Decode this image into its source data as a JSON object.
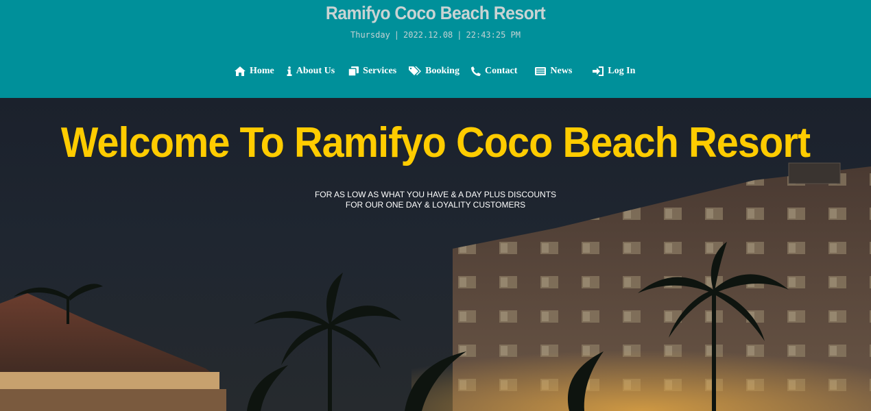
{
  "header": {
    "title": "Ramifyo Coco Beach Resort",
    "day": "Thursday",
    "date": "2022.12.08",
    "time": "22:43:25 PM",
    "background_color": "#00909a"
  },
  "nav": {
    "items": [
      {
        "label": "Home",
        "icon": "home-icon"
      },
      {
        "label": "About Us",
        "icon": "info-icon"
      },
      {
        "label": "Services",
        "icon": "copy-icon"
      },
      {
        "label": "Booking",
        "icon": "tags-icon"
      },
      {
        "label": "Contact",
        "icon": "phone-icon"
      },
      {
        "label": "News",
        "icon": "newspaper-icon"
      },
      {
        "label": "Log In",
        "icon": "sign-in-icon"
      }
    ]
  },
  "hero": {
    "title": "Welcome To Ramifyo Coco Beach Resort",
    "subtitle_line1": "FOR AS LOW AS WHAT YOU HAVE & A DAY PLUS DISCOUNTS",
    "subtitle_line2": "FOR OUR ONE DAY & LOYALITY CUSTOMERS",
    "title_color": "#ffcc00"
  }
}
